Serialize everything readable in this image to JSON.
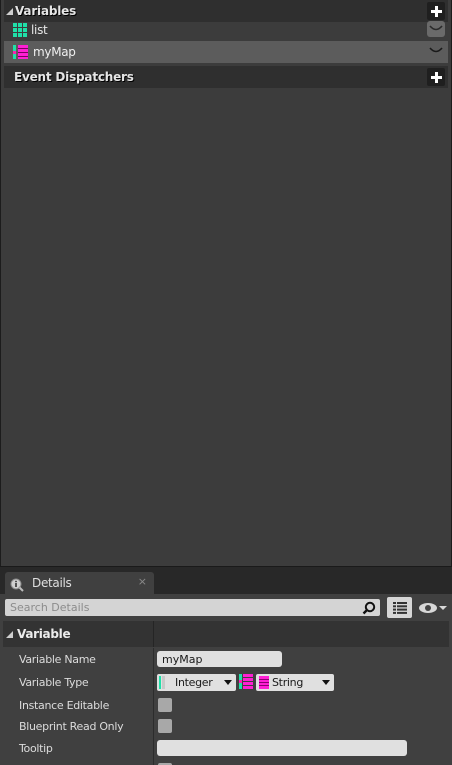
{
  "my_blueprint": {
    "variables_section": {
      "title": "Variables",
      "add_icon": "plus-icon"
    },
    "variables": [
      {
        "name": "list",
        "icon": "array-grid-icon",
        "selected": false
      },
      {
        "name": "myMap",
        "icon": "map-icon",
        "selected": true
      }
    ],
    "event_dispatchers_section": {
      "title": "Event Dispatchers",
      "add_icon": "plus-icon"
    }
  },
  "details": {
    "tab": {
      "title": "Details",
      "icon": "info-icon",
      "close": "×"
    },
    "search": {
      "placeholder": "Search Details",
      "value": ""
    },
    "category": "Variable",
    "properties": {
      "variable_name": {
        "label": "Variable Name",
        "value": "myMap"
      },
      "variable_type": {
        "label": "Variable Type",
        "key_type": "Integer",
        "value_type": "String"
      },
      "instance_editable": {
        "label": "Instance Editable",
        "checked": false
      },
      "blueprint_read_only": {
        "label": "Blueprint Read Only",
        "checked": false
      },
      "tooltip": {
        "label": "Tooltip",
        "value": ""
      }
    }
  },
  "colors": {
    "integer_pin": "#1fe0a8",
    "string_pin": "#ff1fd4",
    "panel_bg": "#3c3c3c",
    "header_bg": "#2f2f2f",
    "selected_row": "#5c5c5c"
  }
}
